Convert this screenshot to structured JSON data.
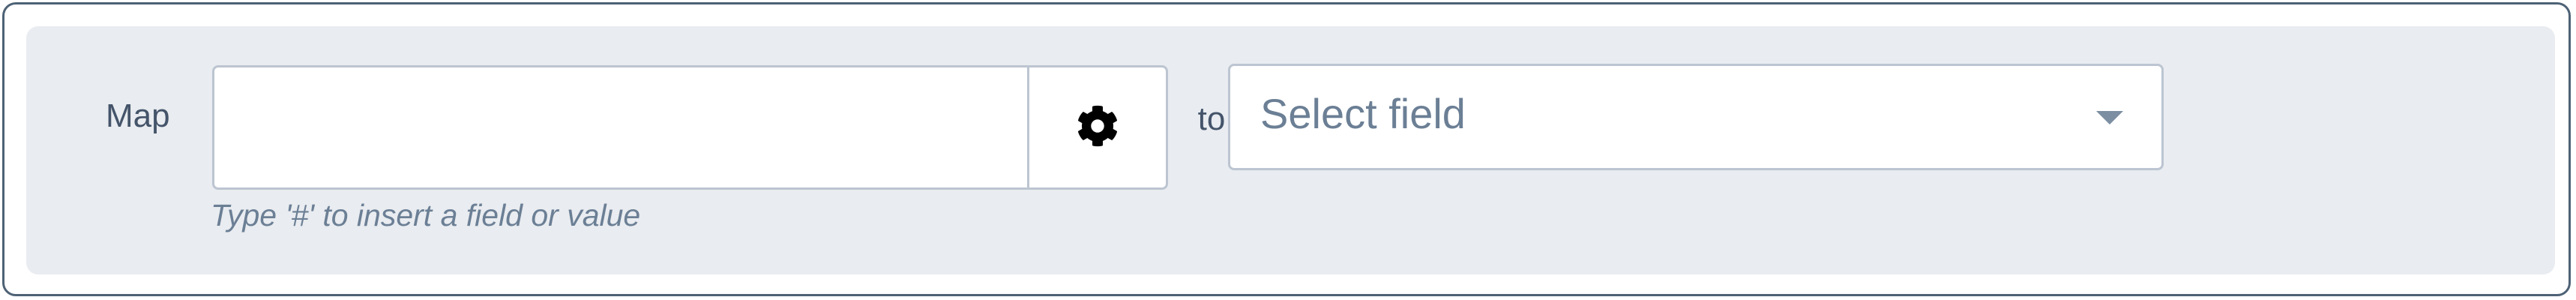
{
  "mapping": {
    "map_label": "Map",
    "source_input": {
      "value": "",
      "placeholder": ""
    },
    "settings_button_icon": "gear-icon",
    "helper_text": "Type '#' to insert a field or value",
    "to_label": "to",
    "target_select": {
      "selected": "Select field",
      "icon": "chevron-down-icon"
    }
  },
  "colors": {
    "border": "#4e6275",
    "panel_background": "#e9ecf0",
    "input_border": "#bcc5d1",
    "label_text": "#44546a",
    "muted_text": "#6b7f95"
  }
}
